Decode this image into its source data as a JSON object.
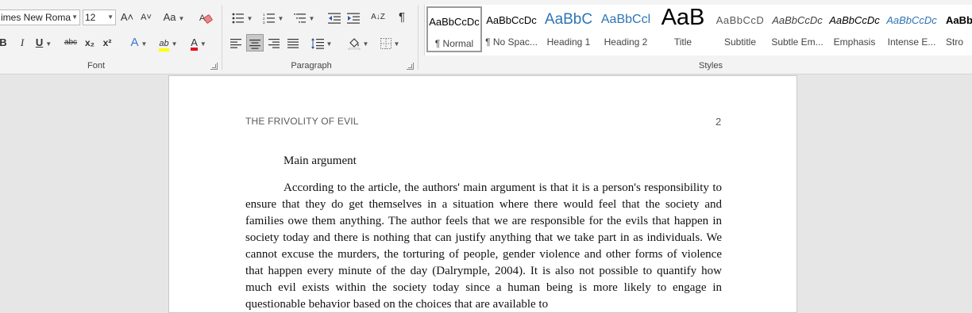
{
  "ribbon": {
    "font": {
      "group_label": "Font",
      "font_name": "imes New Roma",
      "font_size": "12",
      "grow_font_label": "A˄",
      "shrink_font_label": "A˅",
      "change_case_label": "Aa",
      "bold_label": "B",
      "italic_label": "I",
      "underline_label": "U",
      "strikethrough_label": "abc",
      "subscript_label": "x₂",
      "superscript_label": "x²",
      "text_effects_label": "A",
      "highlight_label": "ab",
      "font_color_label": "A",
      "highlight_color": "#ffff00",
      "font_color": "#e81123"
    },
    "paragraph": {
      "group_label": "Paragraph",
      "pilcrow_label": "¶",
      "sort_label": "A↓Z"
    },
    "styles": {
      "group_label": "Styles",
      "items": [
        {
          "sample": "AaBbCcDc",
          "name": "¶ Normal",
          "selected": true
        },
        {
          "sample": "AaBbCcDc",
          "name": "¶ No Spac..."
        },
        {
          "sample": "AaBbC",
          "name": "Heading 1"
        },
        {
          "sample": "AaBbCcl",
          "name": "Heading 2"
        },
        {
          "sample": "AaB",
          "name": "Title"
        },
        {
          "sample": "AaBbCcD",
          "name": "Subtitle"
        },
        {
          "sample": "AaBbCcDc",
          "name": "Subtle Em..."
        },
        {
          "sample": "AaBbCcDc",
          "name": "Emphasis"
        },
        {
          "sample": "AaBbCcDc",
          "name": "Intense E..."
        },
        {
          "sample": "AaBbCc",
          "name": "Stro"
        }
      ]
    }
  },
  "document": {
    "running_head": "THE FRIVOLITY OF EVIL",
    "page_number": "2",
    "heading": "Main argument",
    "paragraph": "According to the article, the authors' main argument is that it is a person's responsibility to ensure that they do get themselves in a situation where there would feel that the society and families owe them anything.  The author feels that we are responsible for the evils that happen in society today and there is nothing that can justify anything that we take part in as individuals. We cannot excuse the murders, the torturing of people, gender violence and other forms of violence that happen every minute of the day (Dalrymple, 2004).  It is also not possible to quantify how much evil exists within the society today since a human being is more likely to engage in questionable behavior based on the choices that are available to"
  }
}
